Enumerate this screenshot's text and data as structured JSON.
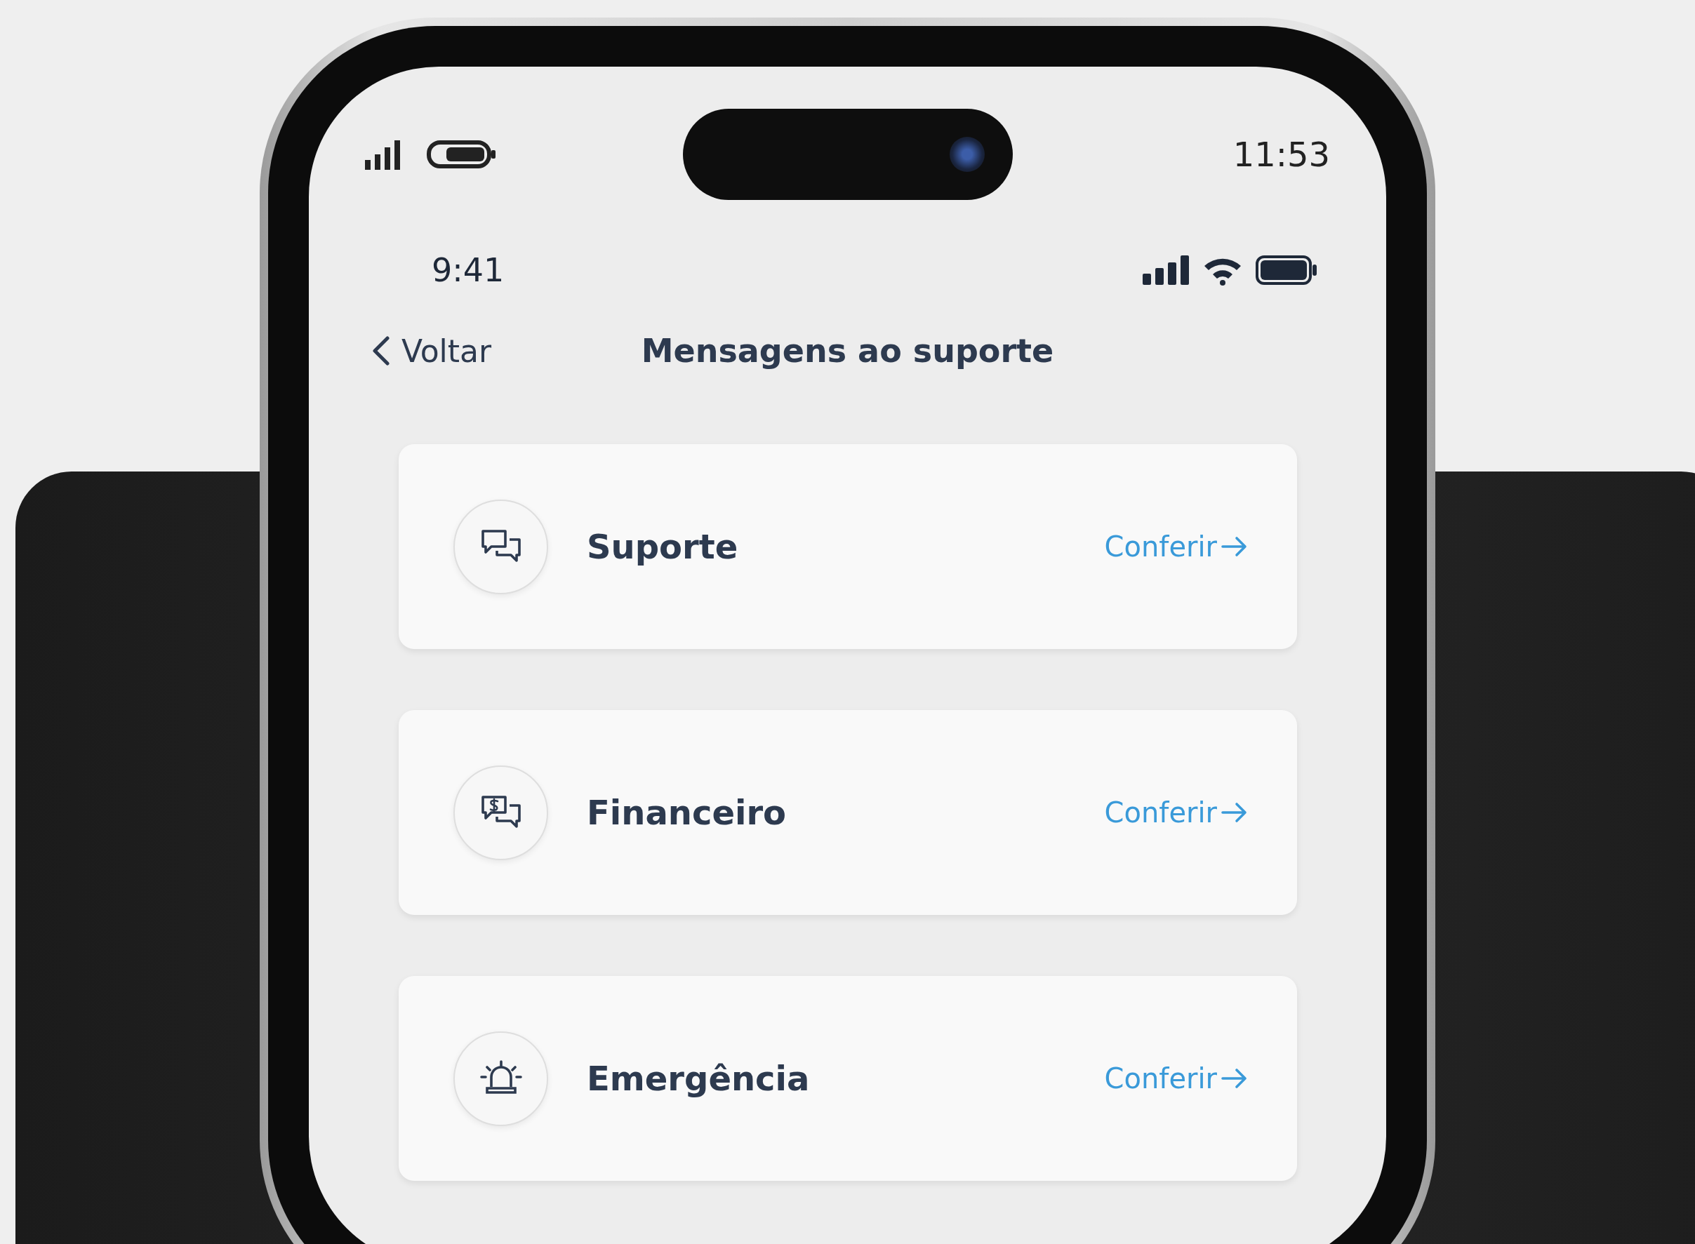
{
  "device_status_bar": {
    "time": "11:53"
  },
  "app_status_bar": {
    "time": "9:41"
  },
  "nav": {
    "back_label": "Voltar",
    "title": "Mensagens ao suporte"
  },
  "cards": [
    {
      "kind": "chat",
      "title": "Suporte",
      "action": "Conferir"
    },
    {
      "kind": "finance",
      "title": "Financeiro",
      "action": "Conferir"
    },
    {
      "kind": "emergency",
      "title": "Emergência",
      "action": "Conferir"
    }
  ]
}
